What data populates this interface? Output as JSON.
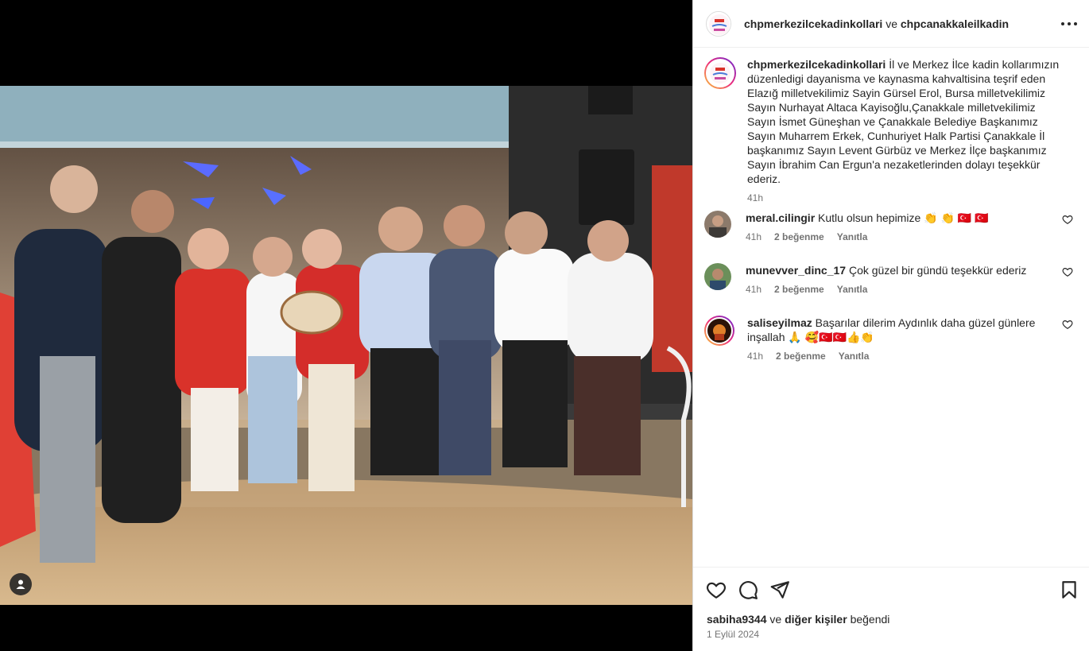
{
  "post": {
    "header_user1": "chpmerkezilcekadinkollari",
    "header_sep": "ve",
    "header_user2": "chpcanakkaleilkadin",
    "more_icon": "more-horizontal-icon"
  },
  "caption": {
    "username": "chpmerkezilcekadinkollari",
    "text": "İl ve Merkez İlce kadin kollarımızın düzenledigi dayanisma ve kaynasma kahvaltisina teşrif eden Elazığ milletvekilimiz Sayin Gürsel Erol, Bursa milletvekilimiz Sayın Nurhayat Altaca Kayisoğlu,Çanakkale milletvekilimiz Sayın İsmet Güneşhan ve Çanakkale Belediye Başkanımız Sayın Muharrem Erkek, Cunhuriyet Halk Partisi Çanakkale İl başkanımız Sayın Levent Gürbüz ve Merkez İlçe başkanımız Sayın İbrahim Can Ergun'a nezaketlerinden dolayı teşekkür ederiz.",
    "time": "41h"
  },
  "comments": [
    {
      "username": "meral.cilingir",
      "text": "Kutlu olsun hepimize 👏 👏 🇹🇷 🇹🇷",
      "time": "41h",
      "likes": "2 beğenme",
      "reply": "Yanıtla"
    },
    {
      "username": "munevver_dinc_17",
      "text": "Çok güzel bir gündü teşekkür ederiz",
      "time": "41h",
      "likes": "2 beğenme",
      "reply": "Yanıtla"
    },
    {
      "username": "saliseyilmaz",
      "text": "Başarılar dilerim Aydınlık daha güzel günlere inşallah 🙏 🥰🇹🇷🇹🇷👍👏",
      "time": "41h",
      "likes": "2 beğenme",
      "reply": "Yanıtla"
    }
  ],
  "footer": {
    "liked_user": "sabiha9344",
    "liked_sep": "ve",
    "liked_others": "diğer kişiler",
    "liked_suffix": "beğendi",
    "date": "1 Eylül 2024"
  },
  "colors": {
    "accent_gradient": [
      "#f9ce34",
      "#ee2a7b",
      "#6228d7"
    ],
    "text_primary": "#262626",
    "text_secondary": "#737373"
  }
}
